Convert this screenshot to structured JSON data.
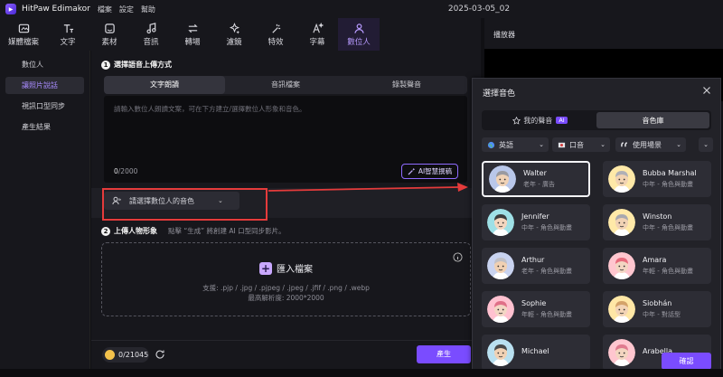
{
  "app": {
    "name": "HitPaw Edimakor",
    "project_title": "2025-03-05_02"
  },
  "menu": [
    "檔案",
    "設定",
    "幫助"
  ],
  "toolbar": [
    {
      "label": "媒體檔案",
      "icon": "media-icon"
    },
    {
      "label": "文字",
      "icon": "text-icon"
    },
    {
      "label": "素材",
      "icon": "sticker-icon"
    },
    {
      "label": "音訊",
      "icon": "music-icon"
    },
    {
      "label": "轉場",
      "icon": "transition-icon"
    },
    {
      "label": "濾鏡",
      "icon": "filter-icon"
    },
    {
      "label": "特效",
      "icon": "effect-icon"
    },
    {
      "label": "字幕",
      "icon": "subtitle-icon"
    },
    {
      "label": "數位人",
      "icon": "avatar-icon",
      "active": true
    }
  ],
  "leftnav": [
    {
      "label": "數位人"
    },
    {
      "label": "讓照片說話",
      "active": true
    },
    {
      "label": "視訊口型同步"
    },
    {
      "label": "產生結果"
    }
  ],
  "step1": {
    "num": "1",
    "title": "選擇語音上傳方式"
  },
  "tabs": [
    {
      "label": "文字朗讀",
      "active": true
    },
    {
      "label": "音訊檔案"
    },
    {
      "label": "錄製聲音"
    }
  ],
  "textarea": {
    "placeholder": "請輸入數位人朗讀文案，可在下方建立/選擇數位人形象和音色。",
    "count": "0",
    "max": "/2000"
  },
  "ai_button": "AI智慧撰稿",
  "voice_select": "請選擇數位人的音色",
  "step2": {
    "num": "2",
    "title": "上傳人物形象",
    "hint": "點擊 “生成” 將創建 AI 口型同步影片。"
  },
  "upload": {
    "label": "匯入檔案",
    "support": "支援: .pjp / .jpg / .pjpeg / .jpeg / .jfif / .png / .webp",
    "maxres": "最高解析度: 2000*2000"
  },
  "credits": "0/21045",
  "generate_button": "產生",
  "player": {
    "title": "播放器"
  },
  "dialog": {
    "title": "選擇音色",
    "tabs": [
      {
        "label": "我的聲音",
        "badge": "AI"
      },
      {
        "label": "音色庫",
        "active": true
      }
    ],
    "filters": [
      {
        "label": "英語",
        "icon": "globe-icon"
      },
      {
        "label": "口音",
        "icon": "flag-icon"
      },
      {
        "label": "使用場景",
        "icon": "quote-icon"
      }
    ],
    "voices": [
      {
        "name": "Walter",
        "desc": "老年 - 廣告",
        "selected": true,
        "skin": "#f0d2b6",
        "hair": "#9a9aa0",
        "bg": "#b9c7ea"
      },
      {
        "name": "Bubba Marshal",
        "desc": "中年 - 角色與動畫",
        "skin": "#f2d3b2",
        "hair": "#b0b0b6",
        "bg": "#ffe9a8"
      },
      {
        "name": "Jennifer",
        "desc": "中年 - 角色與動畫",
        "skin": "#f3d6bf",
        "hair": "#3c3c3c",
        "bg": "#9ee0e6"
      },
      {
        "name": "Winston",
        "desc": "中年 - 角色與動畫",
        "skin": "#f1d2b4",
        "hair": "#a8a8ae",
        "bg": "#ffe9a8"
      },
      {
        "name": "Arthur",
        "desc": "老年 - 角色與動畫",
        "skin": "#f0d0b2",
        "hair": "#c0c0c6",
        "bg": "#c9d3f0"
      },
      {
        "name": "Amara",
        "desc": "年輕 - 角色與動畫",
        "skin": "#f3d5c2",
        "hair": "#e86a7c",
        "bg": "#ffc6cf"
      },
      {
        "name": "Sophie",
        "desc": "年輕 - 角色與動畫",
        "skin": "#f3d6c4",
        "hair": "#e06f88",
        "bg": "#ffc1d0"
      },
      {
        "name": "Siobhán",
        "desc": "中年 - 對話型",
        "skin": "#f3d4b6",
        "hair": "#d4a36a",
        "bg": "#ffe7a6"
      },
      {
        "name": "Michael",
        "desc": "",
        "skin": "#f0d1b4",
        "hair": "#4a4a4a",
        "bg": "#b9e0f0"
      },
      {
        "name": "Arabella",
        "desc": "",
        "skin": "#f3d5c0",
        "hair": "#e07b8f",
        "bg": "#ffc6cf"
      }
    ],
    "confirm_button": "確認"
  },
  "colors": {
    "accent": "#7a4cff",
    "highlight_box": "#e53b3b",
    "active_text": "#a98cff"
  }
}
